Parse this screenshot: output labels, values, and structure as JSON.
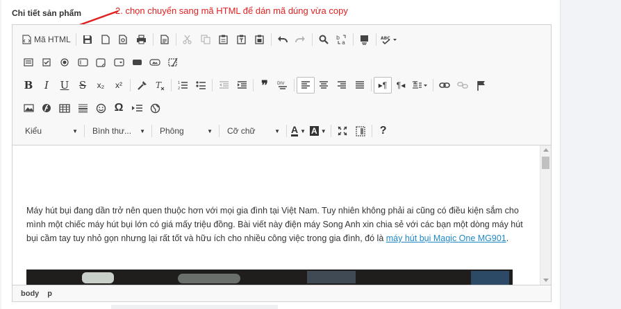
{
  "page": {
    "section_label": "Chi tiết sản phẩm",
    "annotation": "2. chọn chuyển sang mã HTML để dán mã dúng vừa copy"
  },
  "toolbar": {
    "source_label": "Mã HTML",
    "combos": {
      "style": "Kiểu",
      "format": "Bình thư...",
      "font": "Phông",
      "size": "Cỡ chữ"
    },
    "icons": {
      "row1": [
        "source-icon",
        "save-icon",
        "new-page-icon",
        "preview-icon",
        "print-icon",
        "templates-icon",
        "cut-icon",
        "copy-icon",
        "paste-icon",
        "paste-text-icon",
        "paste-word-icon",
        "undo-icon",
        "redo-icon",
        "find-icon",
        "replace-icon",
        "select-all-icon",
        "spellcheck-icon"
      ],
      "row2": [
        "form-icon",
        "checkbox-icon",
        "radio-icon",
        "textfield-icon",
        "textarea-icon",
        "select-icon",
        "button-icon",
        "image-button-icon",
        "hidden-field-icon"
      ],
      "row3": [
        "bold-icon",
        "italic-icon",
        "underline-icon",
        "strike-icon",
        "subscript-icon",
        "superscript-icon",
        "copy-format-icon",
        "remove-format-icon",
        "numbered-list-icon",
        "bulleted-list-icon",
        "outdent-icon",
        "indent-icon",
        "blockquote-icon",
        "div-icon",
        "align-left-icon",
        "align-center-icon",
        "align-right-icon",
        "justify-icon",
        "ltr-icon",
        "rtl-icon",
        "language-icon",
        "link-icon",
        "unlink-icon",
        "anchor-icon"
      ],
      "row4": [
        "image-icon",
        "flash-icon",
        "table-icon",
        "horizontal-rule-icon",
        "smiley-icon",
        "special-char-icon",
        "page-break-icon",
        "iframe-icon"
      ],
      "row5": [
        "text-color-icon",
        "bg-color-icon",
        "maximize-icon",
        "show-blocks-icon",
        "help-icon"
      ]
    },
    "glyphs": {
      "bold": "B",
      "italic": "I",
      "underline": "U",
      "strike": "S",
      "subscript": "x₂",
      "superscript": "x²",
      "quote": "❞",
      "omega": "Ω",
      "help": "?",
      "text_color": "A",
      "bg_color": "A",
      "smiley": "☺",
      "ltr": "▸¶",
      "rtl": "¶◂"
    }
  },
  "content": {
    "paragraph_text": "Máy hút bụi đang dần trở nên quen thuộc hơn với mọi gia đình tại Việt Nam. Tuy nhiên không phải ai cũng có điều kiện sắm cho mình một chiếc máy hút bụi lớn có giá mấy triệu đồng. Bài viết này điện máy Song Anh xin chia sẻ với các bạn một dòng máy hút bụi cầm tay tuy nhỏ gọn nhưng lại rất tốt và hữu ích cho nhiều công việc trong gia đình, đó là ",
    "link_text": "máy hút bụi Magic One MG901",
    "trailing": "."
  },
  "statusbar": {
    "path": [
      "body",
      "p"
    ]
  },
  "colors": {
    "annotation": "#e02020",
    "link": "#1e88c7",
    "toolbar_bg": "#f8f8f8"
  }
}
